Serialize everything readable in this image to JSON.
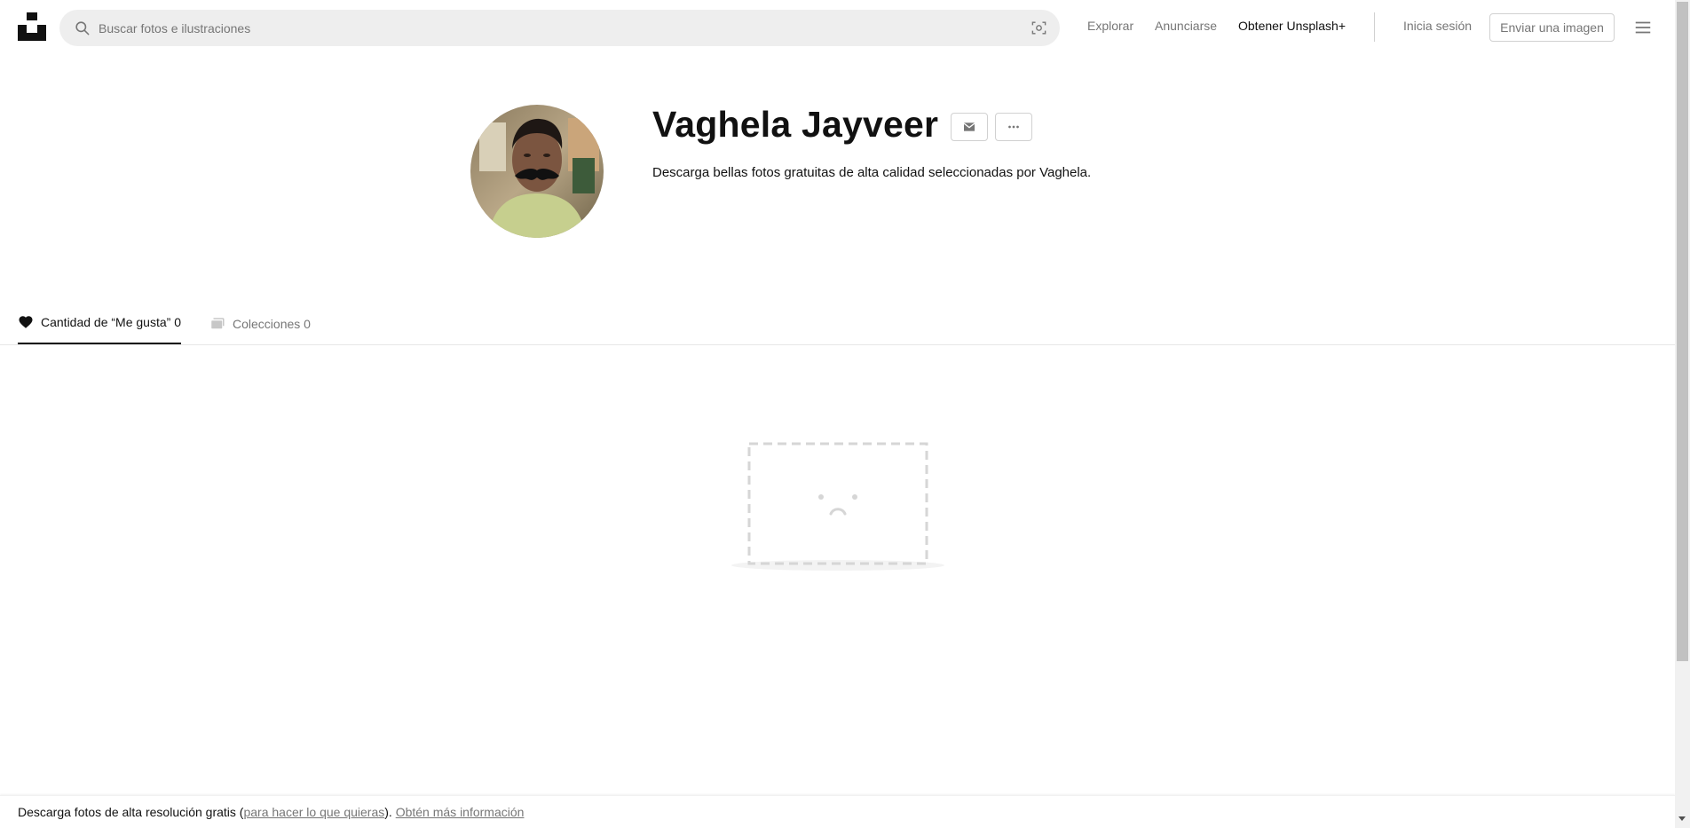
{
  "header": {
    "search_placeholder": "Buscar fotos e ilustraciones",
    "nav": {
      "explore": "Explorar",
      "advertise": "Anunciarse",
      "get_plus": "Obtener Unsplash+",
      "login": "Inicia sesión",
      "submit": "Enviar una imagen"
    }
  },
  "profile": {
    "name": "Vaghela Jayveer",
    "bio": "Descarga bellas fotos gratuitas de alta calidad seleccionadas por Vaghela."
  },
  "tabs": [
    {
      "label": "Cantidad de “Me gusta” 0",
      "icon": "heart-icon",
      "active": true
    },
    {
      "label": "Colecciones 0",
      "icon": "collections-icon",
      "active": false
    }
  ],
  "footer": {
    "text_before": "Descarga fotos de alta resolución gratis (",
    "link_license": "para hacer lo que quieras",
    "text_after": "). ",
    "link_more": "Obtén más información"
  },
  "colors": {
    "text_primary": "#111111",
    "text_secondary": "#767676",
    "search_bg": "#eeeeee",
    "border": "#d1d1d1"
  }
}
